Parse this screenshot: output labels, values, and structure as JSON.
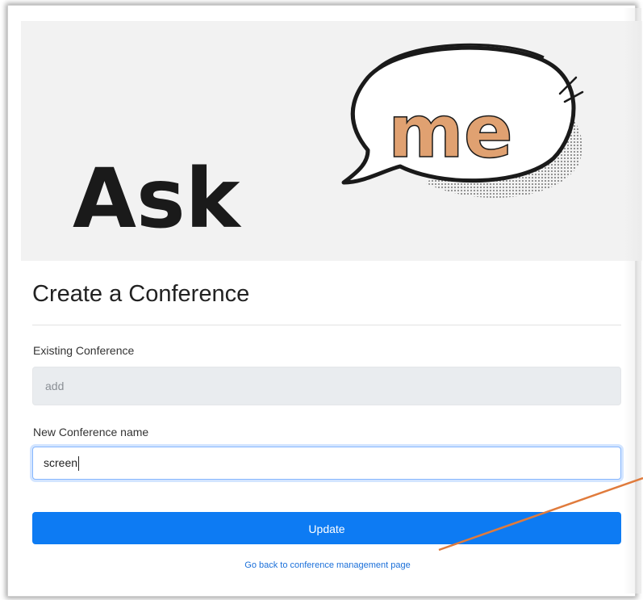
{
  "logo": {
    "word": "Ask",
    "bubble_word": "me",
    "colors": {
      "word": "#1a1a1a",
      "bubble_text": "#e0a171",
      "bubble_outline": "#1a1a1a",
      "background": "#f2f2f2"
    }
  },
  "form": {
    "title": "Create a Conference",
    "existing_label": "Existing Conference",
    "existing_value": "add",
    "new_label": "New Conference name",
    "new_value": "screen",
    "submit_label": "Update",
    "back_link": "Go back to conference management page"
  },
  "colors": {
    "primary": "#0d7bf3",
    "link": "#1a6fd9",
    "annotation_arrow": "#e07b3c"
  }
}
